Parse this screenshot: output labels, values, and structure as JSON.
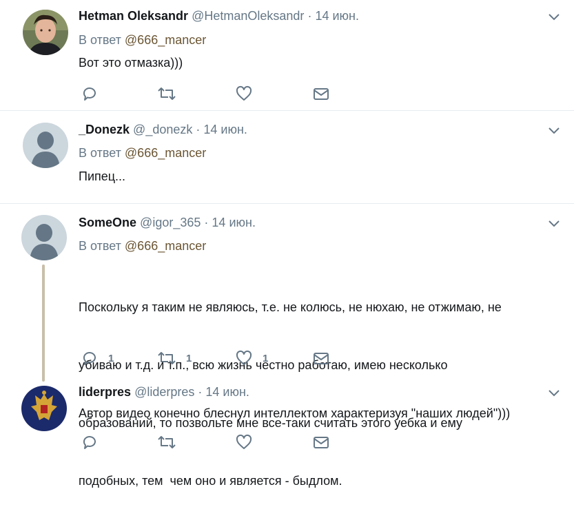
{
  "tweets": [
    {
      "name": "Hetman Oleksandr",
      "handle": "@HetmanOleksandr",
      "dot": "·",
      "date": "14 июн.",
      "reply_prefix": "В ответ",
      "reply_mention": "@666_mancer",
      "text": "Вот это отмазка)))",
      "counts": {
        "reply": "",
        "retweet": "",
        "like": ""
      }
    },
    {
      "name": "_Donezk",
      "handle": "@_donezk",
      "dot": "·",
      "date": "14 июн.",
      "reply_prefix": "В ответ",
      "reply_mention": "@666_mancer",
      "text": "Пипец...",
      "counts": {
        "reply": "",
        "retweet": "",
        "like": ""
      }
    },
    {
      "name": "SomeOne",
      "handle": "@igor_365",
      "dot": "·",
      "date": "14 июн.",
      "reply_prefix": "В ответ",
      "reply_mention": "@666_mancer",
      "text_lines": [
        "Поскольку я таким не являюсь, т.е. не колюсь, не нюхаю, не отжимаю, не",
        "убиваю и т.д. и т.п., всю жизнь честно работаю, имею несколько",
        "образований, то позвольте мне все-таки считать этого уебка и ему",
        "подобных, тем  чем оно и является - быдлом."
      ],
      "counts": {
        "reply": "1",
        "retweet": "1",
        "like": "1"
      }
    },
    {
      "name": "liderpres",
      "handle": "@liderpres",
      "dot": "·",
      "date": "14 июн.",
      "text": "Автор видео конечно блеснул интеллектом характеризуя \"наших людей\")))",
      "counts": {
        "reply": "",
        "retweet": "",
        "like": ""
      }
    }
  ],
  "colors": {
    "text_primary": "#14171a",
    "text_secondary": "#657786",
    "mention": "#6b5634",
    "icon": "#657786",
    "divider": "#e6ecf0",
    "thread_line": "#c9bfa8",
    "default_avatar_bg": "#ccd6dd",
    "default_avatar_figure": "#657786"
  },
  "icons": {
    "reply": "speech-bubble-icon",
    "retweet": "retweet-arrows-icon",
    "like": "heart-icon",
    "dm": "envelope-icon",
    "more": "chevron-down-icon"
  }
}
